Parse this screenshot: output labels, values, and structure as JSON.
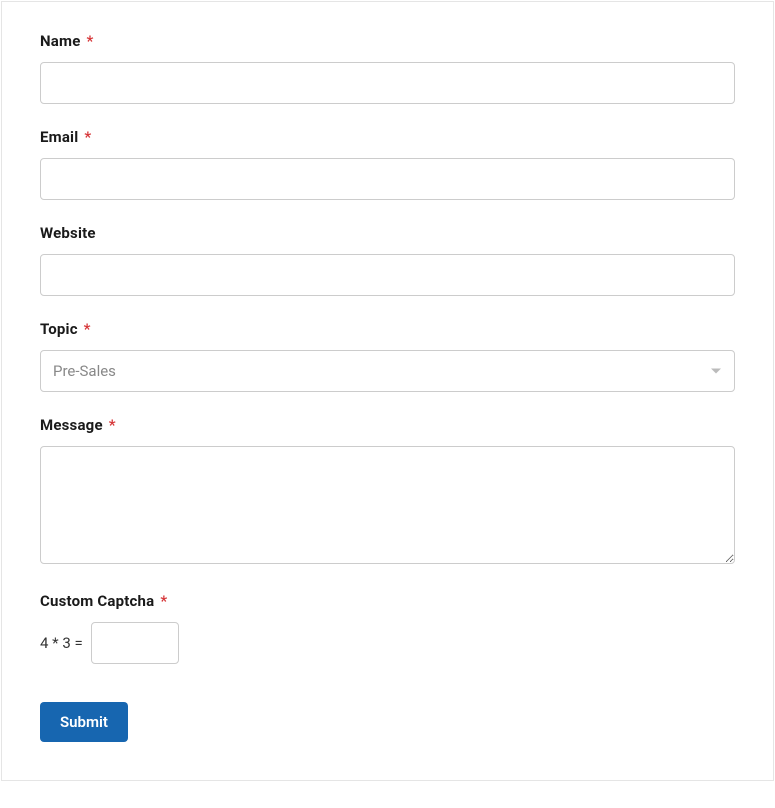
{
  "form": {
    "name": {
      "label": "Name",
      "required": "*",
      "value": ""
    },
    "email": {
      "label": "Email",
      "required": "*",
      "value": ""
    },
    "website": {
      "label": "Website",
      "value": ""
    },
    "topic": {
      "label": "Topic",
      "required": "*",
      "selected": "Pre-Sales"
    },
    "message": {
      "label": "Message",
      "required": "*",
      "value": ""
    },
    "captcha": {
      "label": "Custom Captcha",
      "required": "*",
      "question": "4 * 3 =",
      "value": ""
    },
    "submit": {
      "label": "Submit"
    }
  }
}
